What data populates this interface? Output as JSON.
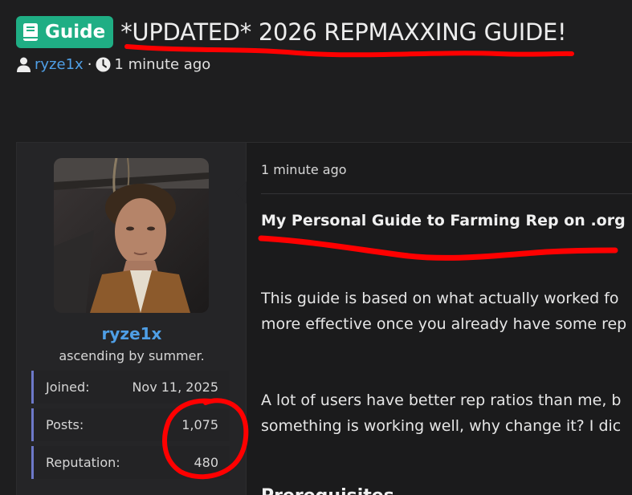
{
  "thread": {
    "prefix_label": "Guide",
    "prefix_icon": "book-icon",
    "title": "*UPDATED* 2026 REPMAXXING GUIDE!",
    "author": "ryze1x",
    "separator": "·",
    "time_ago": "1 minute ago"
  },
  "user": {
    "username": "ryze1x",
    "user_title": "ascending by summer.",
    "stats": [
      {
        "label": "Joined:",
        "value": "Nov 11, 2025"
      },
      {
        "label": "Posts:",
        "value": "1,075"
      },
      {
        "label": "Reputation:",
        "value": "480"
      }
    ]
  },
  "message": {
    "date": "1 minute ago",
    "heading": "My Personal Guide to Farming Rep on .org",
    "para1_line1": "This guide is based on what actually worked fo",
    "para1_line2": "more effective once you already have some rep",
    "para2_line1": "A lot of users have better rep ratios than me, b",
    "para2_line2": "something is working well, why change it? I dic",
    "section_heading": "Prerequisites"
  },
  "colors": {
    "prefix_badge": "#1fae84",
    "link": "#4f9fe6",
    "stat_accent": "#6d79c9",
    "annotation": "#ff0000"
  }
}
